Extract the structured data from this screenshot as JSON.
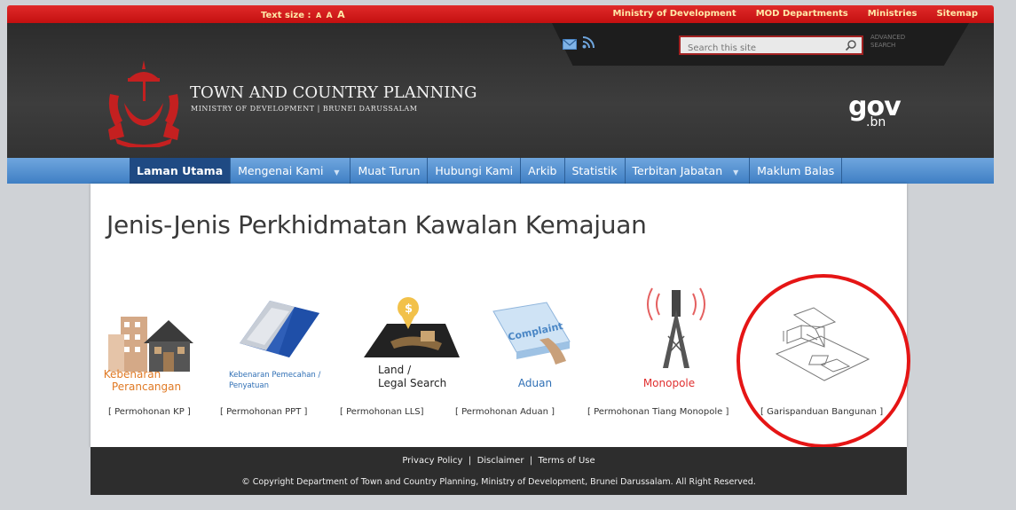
{
  "topbar": {
    "text_size_label": "Text size :",
    "text_size_options": [
      "A",
      "A",
      "A"
    ],
    "links": [
      "Ministry of Development",
      "MOD Departments",
      "Ministries",
      "Sitemap"
    ]
  },
  "header": {
    "search_placeholder": "Search this site",
    "advanced_search": [
      "ADVANCED",
      "SEARCH"
    ],
    "title": "TOWN AND COUNTRY PLANNING",
    "subtitle": "MINISTRY OF DEVELOPMENT | BRUNEI DARUSSALAM",
    "gov_main": "gov",
    "gov_suffix": ".bn"
  },
  "nav": {
    "items": [
      "Laman Utama",
      "Mengenai Kami",
      "Muat Turun",
      "Hubungi Kami",
      "Arkib",
      "Statistik",
      "Terbitan Jabatan",
      "Maklum Balas"
    ],
    "active_item": "Laman Utama",
    "dropdown_items": [
      "Mengenai Kami",
      "Terbitan Jabatan"
    ]
  },
  "main": {
    "title": "Jenis-Jenis Perkhidmatan Kawalan Kemajuan",
    "services": [
      {
        "icon": "houses-icon",
        "caption_lines": [
          "Kebenaran",
          "Perancangan"
        ],
        "link": "[ Permohonan KP ]"
      },
      {
        "icon": "land-subdivision-icon",
        "caption_lines": [
          "Kebenaran Pemecahan /",
          "Penyatuan"
        ],
        "link": "[ Permohonan PPT ]"
      },
      {
        "icon": "land-search-icon",
        "caption_lines": [
          "Land /",
          "Legal Search"
        ],
        "link": "[ Permohonan LLS]"
      },
      {
        "icon": "complaint-key-icon",
        "caption_lines": [
          "Aduan"
        ],
        "key_text": "Complaint",
        "link": "[ Permohonan Aduan ]"
      },
      {
        "icon": "monopole-tower-icon",
        "caption_lines": [
          "Monopole"
        ],
        "link": "[ Permohonan Tiang Monopole ]"
      },
      {
        "icon": "building-plan-icon",
        "caption_lines": [],
        "link": "[ Garispanduan Bangunan ]"
      }
    ]
  },
  "footer": {
    "links": [
      "Privacy Policy",
      "Disclaimer",
      "Terms of Use"
    ],
    "separator": "|",
    "copyright": "© Copyright Department of Town and Country Planning, Ministry of Development, Brunei Darussalam. All Right Reserved."
  },
  "colors": {
    "topbar_red": "#d41c1c",
    "nav_blue": "#4f8fd1",
    "nav_active": "#1f4a83",
    "highlight_red": "#e51515",
    "caption_orange": "#e07a25",
    "caption_blue": "#2f6fb5",
    "caption_red": "#e03030"
  }
}
